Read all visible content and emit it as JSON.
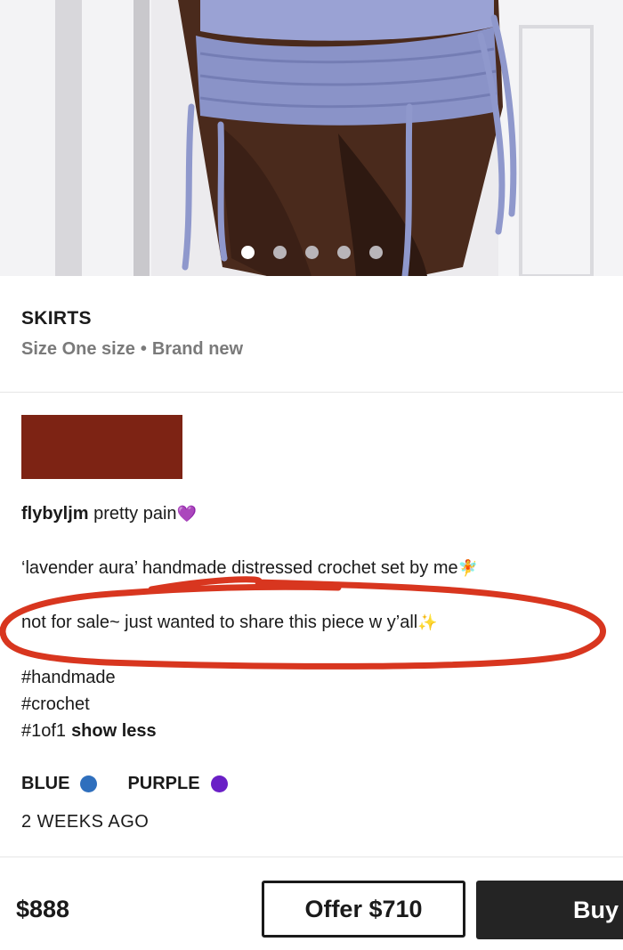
{
  "carousel": {
    "total": 5,
    "active_index": 0
  },
  "item": {
    "category": "SKIRTS",
    "size_label": "Size One size",
    "condition": "Brand new",
    "separator": "•"
  },
  "description": {
    "username": "flybyljm",
    "tagline": "pretty pain",
    "tagline_emoji": "💜",
    "line1": "‘lavender aura’ handmade distressed crochet set by me",
    "line1_emoji": "🧚",
    "line2": "not for sale~ just wanted to share this piece w y’all",
    "line2_emoji": "✨",
    "hashtags": [
      "#handmade",
      "#crochet",
      "#1of1"
    ],
    "show_less": "show less"
  },
  "colors": [
    {
      "label": "BLUE",
      "hex": "#2f6fbd"
    },
    {
      "label": "PURPLE",
      "hex": "#6a1fc6"
    }
  ],
  "posted": "2 WEEKS AGO",
  "bottom_bar": {
    "price": "$888",
    "offer_label": "Offer $710",
    "buy_label": "Buy"
  },
  "annotation_color": "#d8361f",
  "redaction_color": "#7d2314"
}
